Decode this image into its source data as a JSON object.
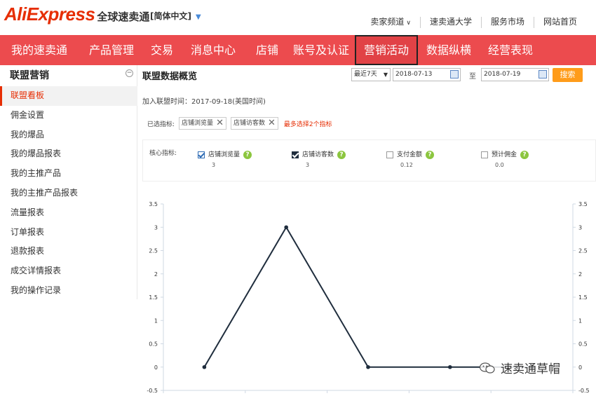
{
  "header": {
    "logo_main": "AliExpress",
    "logo_cn": "全球速卖通",
    "language": "[简体中文]",
    "links": [
      "卖家频道",
      "速卖通大学",
      "服务市场",
      "网站首页"
    ]
  },
  "nav": {
    "items": [
      "我的速卖通",
      "产品管理",
      "交易",
      "消息中心",
      "店铺",
      "账号及认证",
      "营销活动",
      "数据纵横",
      "经营表现"
    ],
    "active": "营销活动"
  },
  "sidebar": {
    "title": "联盟营销",
    "collapse": "−",
    "items": [
      "联盟看板",
      "佣金设置",
      "我的爆品",
      "我的爆品报表",
      "我的主推产品",
      "我的主推产品报表",
      "流量报表",
      "订单报表",
      "退款报表",
      "成交详情报表",
      "我的操作记录"
    ],
    "active": "联盟看板"
  },
  "main": {
    "title": "联盟数据概览",
    "range": "最近7天",
    "date_from": "2018-07-13",
    "to_label": "至",
    "date_to": "2018-07-19",
    "search": "搜索",
    "join_time": "加入联盟时间：2017-09-18(美国时间)",
    "selected_label": "已选指标:",
    "chips": [
      "店铺浏览量",
      "店铺访客数"
    ],
    "max_note": "最多选择2个指标",
    "core_label": "核心指标:",
    "metrics": [
      {
        "name": "店铺浏览量",
        "value": "3",
        "checked": true
      },
      {
        "name": "店铺访客数",
        "value": "3",
        "checked": true
      },
      {
        "name": "支付金额",
        "value": "0.12",
        "checked": false
      },
      {
        "name": "预计佣金",
        "value": "0.0",
        "checked": false
      }
    ]
  },
  "chart_data": {
    "type": "line",
    "x": [
      1,
      2,
      3,
      4,
      5
    ],
    "series": [
      {
        "values": [
          0,
          3,
          0,
          0,
          0
        ],
        "color": "#1f2d3d"
      }
    ],
    "ylim": [
      -0.5,
      3.5
    ],
    "yticks": [
      "3.5",
      "3",
      "2.5",
      "2",
      "1.5",
      "1",
      "0.5",
      "0",
      "-0.5"
    ],
    "grid": false
  },
  "watermark": {
    "text": "速卖通草帽"
  }
}
